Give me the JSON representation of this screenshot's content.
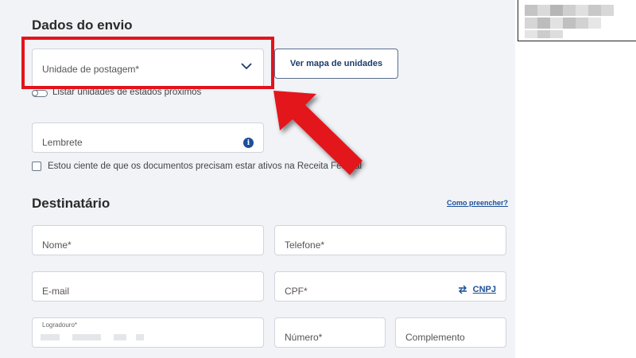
{
  "shipping": {
    "title": "Dados do envio",
    "unit_placeholder": "Unidade de postagem*",
    "map_button_label": "Ver mapa de unidades",
    "toggle_label": "Listar unidades de estados próximos",
    "reminder_placeholder": "Lembrete",
    "info_icon": "i",
    "checkbox_label": "Estou ciente de que os documentos precisam estar ativos na Receita Federal"
  },
  "recipient": {
    "title": "Destinatário",
    "help_link": "Como preencher?",
    "name_placeholder": "Nome*",
    "phone_placeholder": "Telefone*",
    "email_placeholder": "E-mail",
    "cpf_placeholder": "CPF*",
    "cnpj_label": "CNPJ",
    "street_label": "Logradouro*",
    "number_placeholder": "Número*",
    "complement_placeholder": "Complemento"
  },
  "colors": {
    "accent": "#1c4f99",
    "highlight": "#e3131b",
    "page_bg": "#f1f3f7"
  },
  "icons": {
    "dropdown": "chevron-down-icon",
    "info": "info-icon",
    "swap": "swap-arrows-icon",
    "annotation": "red-arrow-icon"
  }
}
